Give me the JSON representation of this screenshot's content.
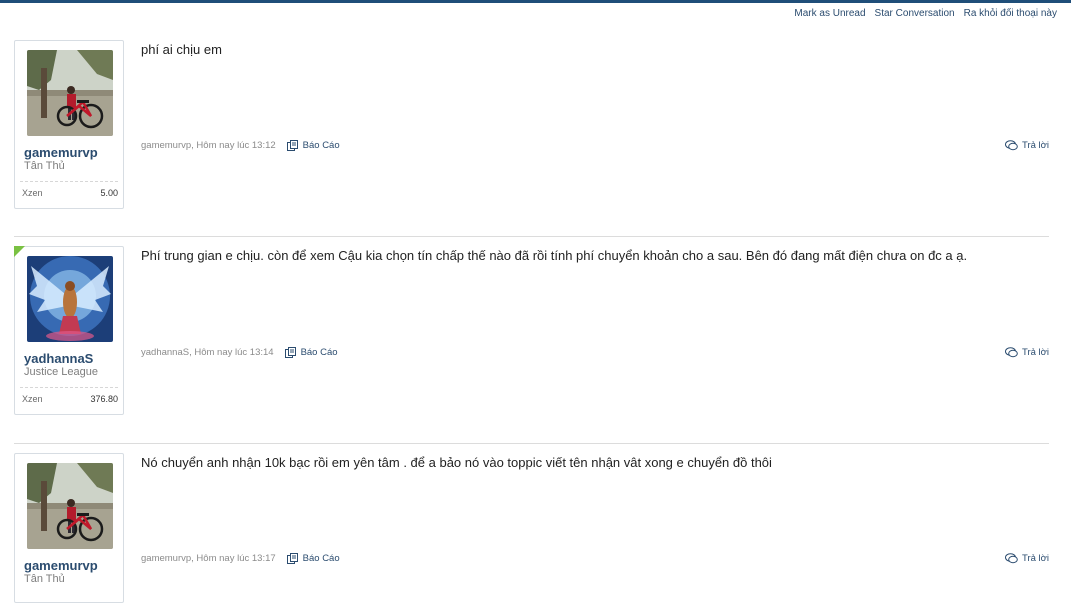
{
  "conversation_actions": {
    "mark_unread": "Mark as Unread",
    "star": "Star Conversation",
    "leave": "Ra khỏi đối thoại này"
  },
  "messages": [
    {
      "username": "gamemurvp",
      "user_title": "Tân Thủ",
      "stat_label": "Xzen",
      "stat_value": "5.00",
      "text": "phí ai chịu em",
      "meta": "gamemurvp, Hôm nay lúc 13:12",
      "report_label": "Báo Cáo",
      "reply_label": "Trả lời",
      "avatar": "boy-with-bicycle"
    },
    {
      "username": "yadhannaS",
      "user_title": "Justice League",
      "stat_label": "Xzen",
      "stat_value": "376.80",
      "text": "Phí trung gian e chịu. còn để xem Cậu kia chọn tín chấp thế nào đã rồi tính phí chuyển khoản cho a sau. Bên đó đang mất điện chưa on đc a ạ.",
      "meta": "yadhannaS, Hôm nay lúc 13:14",
      "report_label": "Báo Cáo",
      "reply_label": "Trả lời",
      "avatar": "winged-angel"
    },
    {
      "username": "gamemurvp",
      "user_title": "Tân Thủ",
      "text": "Nó chuyển anh nhận 10k bạc rồi em yên tâm . để a bảo nó vào toppic viết tên nhận vât xong e chuyển đồ thôi",
      "meta": "gamemurvp, Hôm nay lúc 13:17",
      "report_label": "Báo Cáo",
      "reply_label": "Trả lời",
      "avatar": "boy-with-bicycle"
    }
  ],
  "colors": {
    "link": "#2b4c6f",
    "staff_badge": "#7ac143",
    "header_rule": "#1f4e79"
  }
}
